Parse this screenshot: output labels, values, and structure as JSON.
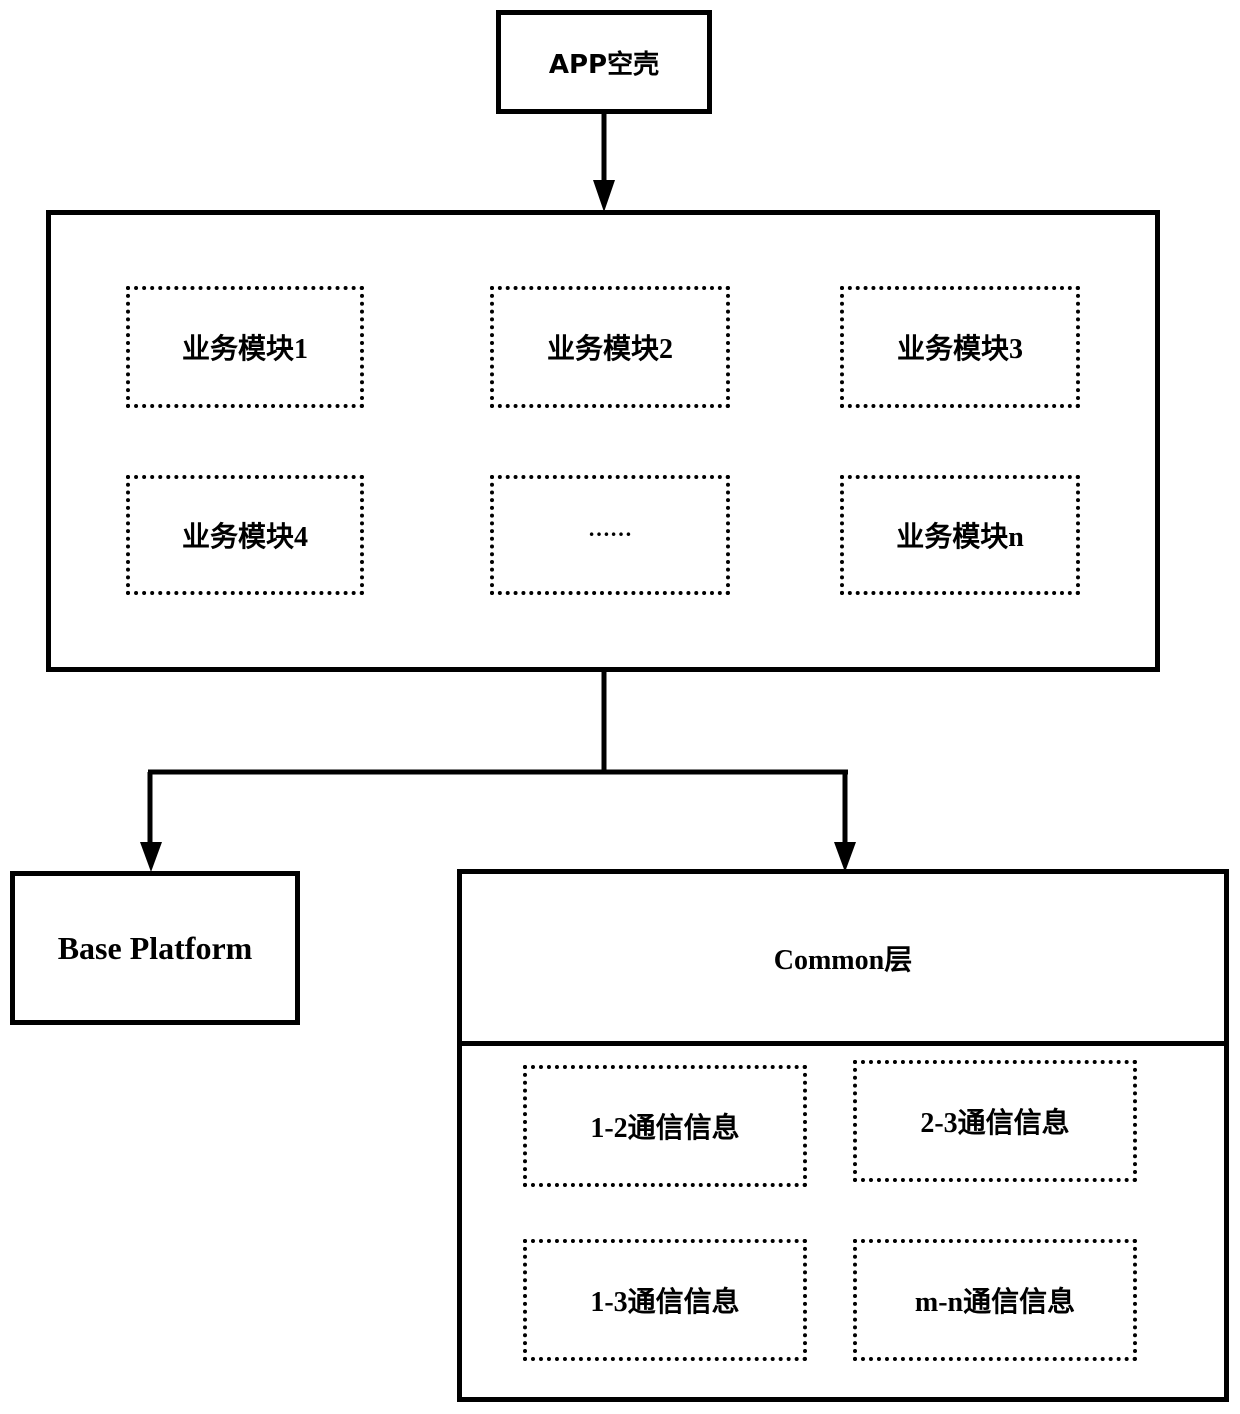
{
  "app_shell": {
    "label": "APP空壳"
  },
  "business_container": {
    "modules": [
      {
        "label": "业务模块1"
      },
      {
        "label": "业务模块2"
      },
      {
        "label": "业务模块3"
      },
      {
        "label": "业务模块4"
      },
      {
        "label": "……"
      },
      {
        "label": "业务模块n"
      }
    ]
  },
  "base_platform": {
    "label": "Base Platform"
  },
  "common_layer": {
    "title": "Common层",
    "items": [
      {
        "label": "1-2通信信息"
      },
      {
        "label": "2-3通信信息"
      },
      {
        "label": "1-3通信信息"
      },
      {
        "label": "m-n通信信息"
      }
    ]
  },
  "colors": {
    "stroke": "#000000",
    "background": "#ffffff"
  }
}
